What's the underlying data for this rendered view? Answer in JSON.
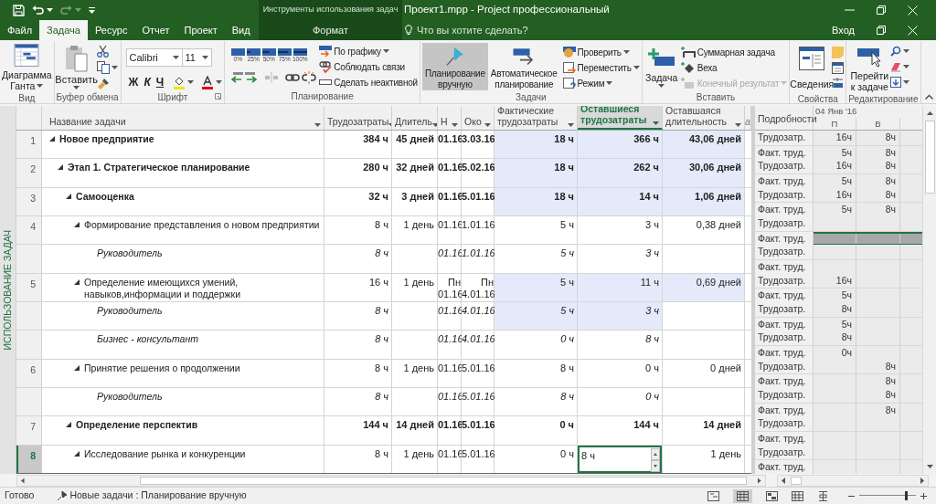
{
  "window": {
    "title": "Проект1.mpp - Project профессиональный",
    "context_title": "Инструменты использования задач",
    "sign_in": "Вход"
  },
  "tabs": [
    {
      "label": "Файл",
      "selected": false
    },
    {
      "label": "Задача",
      "selected": true
    },
    {
      "label": "Ресурс",
      "selected": false
    },
    {
      "label": "Отчет",
      "selected": false
    },
    {
      "label": "Проект",
      "selected": false
    },
    {
      "label": "Вид",
      "selected": false
    }
  ],
  "context_tabs": [
    {
      "label": "Формат",
      "selected": false
    }
  ],
  "tell_me": {
    "placeholder": "Что вы хотите сделать?"
  },
  "ribbon": {
    "view_group": {
      "label": "Вид",
      "gantt_button": [
        "Диаграмма",
        "Ганта"
      ]
    },
    "clipboard_group": {
      "label": "Буфер обмена",
      "paste_button": "Вставить"
    },
    "font_group": {
      "label": "Шрифт",
      "font": "Calibri",
      "size": "11",
      "bold": "Ж",
      "italic": "К",
      "underline": "Ч"
    },
    "schedule_group": {
      "label": "Планирование",
      "percent_buttons": [
        "0%",
        "25%",
        "50%",
        "75%",
        "100%"
      ],
      "commands": [
        "По графику",
        "Соблюдать связи",
        "Сделать неактивной"
      ]
    },
    "tasks_group": {
      "label": "Задачи",
      "manual_button": {
        "label": [
          "Планирование",
          "вручную"
        ],
        "selected": true
      },
      "auto_button": {
        "label": [
          "Автоматическое",
          "планирование"
        ],
        "selected": false
      },
      "commands": [
        "Проверить",
        "Переместить",
        "Режим"
      ]
    },
    "insert_group": {
      "label": "Вставить",
      "task_button": "Задача",
      "commands": [
        {
          "label": "Суммарная задача",
          "disabled": false
        },
        {
          "label": "Веха",
          "disabled": false
        },
        {
          "label": "Конечный результат",
          "disabled": true
        }
      ]
    },
    "properties_group": {
      "label": "Свойства",
      "info_button": "Сведения"
    },
    "editing_group": {
      "label": "Редактирование",
      "goto_button": [
        "Перейти",
        "к задаче"
      ]
    }
  },
  "view_label": "ИСПОЛЬЗОВАНИЕ ЗАДАЧ",
  "table": {
    "columns": [
      {
        "label": "Название задачи",
        "selected": false
      },
      {
        "label": "Трудозатраты",
        "selected": false
      },
      {
        "label": "Длитель",
        "selected": false
      },
      {
        "label": "Н",
        "selected": false
      },
      {
        "label": "Око",
        "selected": false
      },
      {
        "label": "Фактические трудозатраты",
        "selected": false
      },
      {
        "label": "Оставшиеся трудозатраты",
        "selected": true
      },
      {
        "label": "Оставшаяся длительность",
        "selected": false
      },
      {
        "label": "a",
        "selected": false
      }
    ],
    "rows": [
      {
        "id": "1",
        "kind": "summary",
        "name": "Новое предприятие",
        "expanded": true,
        "selected": false,
        "highlighted": true,
        "work": "384 ч",
        "duration": "45 дней",
        "start": "01.16",
        "finish": "3.03.16",
        "actual_work": "18 ч",
        "remaining_work": "366 ч",
        "remaining_duration": "43,06 дней",
        "details": [
          {
            "label": "Трудозатр.",
            "selected": false,
            "monday": "16ч",
            "tuesday": "8ч"
          },
          {
            "label": "Факт. труд.",
            "selected": false,
            "monday": "5ч",
            "tuesday": "8ч"
          }
        ],
        "children": [
          {
            "id": "2",
            "kind": "summary",
            "name": "Этап 1. Стратегическое планирование",
            "expanded": true,
            "selected": false,
            "highlighted": true,
            "work": "280 ч",
            "duration": "32 дней",
            "start": "01.16",
            "finish": "5.02.16",
            "actual_work": "18 ч",
            "remaining_work": "262 ч",
            "remaining_duration": "30,06 дней",
            "details": [
              {
                "label": "Трудозатр.",
                "selected": false,
                "monday": "16ч",
                "tuesday": "8ч"
              },
              {
                "label": "Факт. труд.",
                "selected": false,
                "monday": "5ч",
                "tuesday": "8ч"
              }
            ],
            "children": [
              {
                "id": "3",
                "kind": "summary",
                "name": "Самооценка",
                "expanded": true,
                "selected": false,
                "highlighted": true,
                "work": "32 ч",
                "duration": "3 дней",
                "start": "01.16",
                "finish": "5.01.16",
                "actual_work": "18 ч",
                "remaining_work": "14 ч",
                "remaining_duration": "1,06 дней",
                "details": [
                  {
                    "label": "Трудозатр.",
                    "selected": false,
                    "monday": "16ч",
                    "tuesday": "8ч"
                  },
                  {
                    "label": "Факт. труд.",
                    "selected": false,
                    "monday": "5ч",
                    "tuesday": "8ч"
                  }
                ],
                "children": [
                  {
                    "id": "4",
                    "kind": "task",
                    "name": "Формирование представления о новом предприятии",
                    "expanded": true,
                    "selected": false,
                    "highlighted": false,
                    "work": "8 ч",
                    "duration": "1 день",
                    "start": "01.16",
                    "finish": "1.01.16",
                    "actual_work": "5 ч",
                    "remaining_work": "3 ч",
                    "remaining_duration": "0,38 дней",
                    "details": [
                      {
                        "label": "Трудозатр.",
                        "selected": false
                      },
                      {
                        "label": "Факт. труд.",
                        "selected": true
                      }
                    ],
                    "children": [
                      {
                        "kind": "assignment",
                        "name": "Руководитель",
                        "selected": false,
                        "highlighted": false,
                        "work": "8 ч",
                        "start": "01.16",
                        "finish": "1.01.16",
                        "actual_work": "5 ч",
                        "remaining_work": "3 ч",
                        "details": [
                          {
                            "label": "Трудозатр.",
                            "selected": false
                          },
                          {
                            "label": "Факт. труд.",
                            "selected": false
                          }
                        ]
                      }
                    ]
                  },
                  {
                    "id": "5",
                    "kind": "task",
                    "name": "Определение имеющихся умений, навыков,информации и поддержки",
                    "expanded": true,
                    "selected": false,
                    "highlighted": true,
                    "work": "16 ч",
                    "duration": "1 день",
                    "start": "Пн 01.16",
                    "finish": "Пн 4.01.16",
                    "actual_work": "5 ч",
                    "remaining_work": "11 ч",
                    "remaining_duration": "0,69 дней",
                    "details": [
                      {
                        "label": "Трудозатр.",
                        "selected": false,
                        "monday": "16ч"
                      },
                      {
                        "label": "Факт. труд.",
                        "selected": false,
                        "monday": "5ч"
                      }
                    ],
                    "children": [
                      {
                        "kind": "assignment",
                        "name": "Руководитель",
                        "selected": false,
                        "highlighted": true,
                        "work": "8 ч",
                        "start": "01.16",
                        "finish": "4.01.16",
                        "actual_work": "5 ч",
                        "remaining_work": "3 ч",
                        "details": [
                          {
                            "label": "Трудозатр.",
                            "selected": false,
                            "monday": "8ч"
                          },
                          {
                            "label": "Факт. труд.",
                            "selected": false,
                            "monday": "5ч"
                          }
                        ]
                      },
                      {
                        "kind": "assignment",
                        "name": "Бизнес - консультант",
                        "selected": false,
                        "highlighted": false,
                        "work": "8 ч",
                        "start": "01.16",
                        "finish": "4.01.16",
                        "actual_work": "0 ч",
                        "remaining_work": "8 ч",
                        "details": [
                          {
                            "label": "Трудозатр.",
                            "selected": false,
                            "monday": "8ч"
                          },
                          {
                            "label": "Факт. труд.",
                            "selected": false,
                            "monday": "0ч"
                          }
                        ]
                      }
                    ]
                  },
                  {
                    "id": "6",
                    "kind": "task",
                    "name": "Принятие решения о продолжении",
                    "expanded": true,
                    "selected": false,
                    "highlighted": false,
                    "work": "8 ч",
                    "duration": "1 день",
                    "start": "01.16",
                    "finish": "5.01.16",
                    "actual_work": "8 ч",
                    "remaining_work": "0 ч",
                    "remaining_duration": "0 дней",
                    "details": [
                      {
                        "label": "Трудозатр.",
                        "selected": false,
                        "tuesday": "8ч"
                      },
                      {
                        "label": "Факт. труд.",
                        "selected": false,
                        "tuesday": "8ч"
                      }
                    ],
                    "children": [
                      {
                        "kind": "assignment",
                        "name": "Руководитель",
                        "selected": false,
                        "highlighted": false,
                        "work": "8 ч",
                        "start": "01.16",
                        "finish": "5.01.16",
                        "actual_work": "8 ч",
                        "remaining_work": "0 ч",
                        "details": [
                          {
                            "label": "Трудозатр.",
                            "selected": false,
                            "tuesday": "8ч"
                          },
                          {
                            "label": "Факт. труд.",
                            "selected": false,
                            "tuesday": "8ч"
                          }
                        ]
                      }
                    ]
                  }
                ]
              },
              {
                "id": "7",
                "kind": "summary",
                "name": "Определение перспектив",
                "expanded": true,
                "selected": false,
                "highlighted": false,
                "work": "144 ч",
                "duration": "14 дней",
                "start": "01.16",
                "finish": "5.01.16",
                "actual_work": "0 ч",
                "remaining_work": "144 ч",
                "remaining_duration": "14 дней",
                "details": [
                  {
                    "label": "Трудозатр.",
                    "selected": false
                  },
                  {
                    "label": "Факт. труд.",
                    "selected": false
                  }
                ],
                "children": [
                  {
                    "id": "8",
                    "kind": "task",
                    "name": "Исследование рынка и конкуренции",
                    "expanded": true,
                    "selected": true,
                    "highlighted": false,
                    "work": "8 ч",
                    "duration": "1 день",
                    "start": "01.16",
                    "finish": "5.01.16",
                    "actual_work": "0 ч",
                    "remaining_work": "8 ч",
                    "remaining_duration": "1 день",
                    "details": [
                      {
                        "label": "Трудозатр.",
                        "selected": false
                      },
                      {
                        "label": "Факт. труд.",
                        "selected": false
                      }
                    ]
                  }
                ]
              }
            ]
          }
        ]
      }
    ]
  },
  "timescale": {
    "details_label": "Подробности",
    "date": "04 Янв '16",
    "days": [
      "П",
      "В"
    ]
  },
  "status_bar": {
    "ready": "Готово",
    "new_tasks": "Новые задачи : Планирование вручную",
    "zoom": {
      "level": 0.85
    }
  }
}
